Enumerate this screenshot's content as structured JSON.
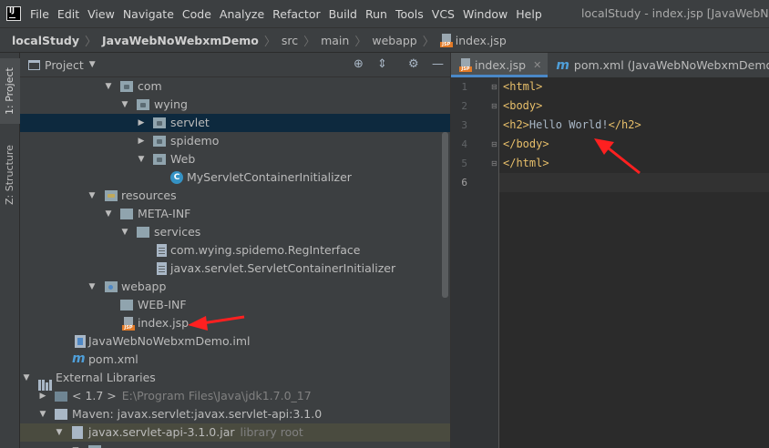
{
  "menubar": {
    "items": [
      "File",
      "Edit",
      "View",
      "Navigate",
      "Code",
      "Analyze",
      "Refactor",
      "Build",
      "Run",
      "Tools",
      "VCS",
      "Window",
      "Help"
    ],
    "window_title": "localStudy - index.jsp [JavaWebNoW"
  },
  "breadcrumb": [
    "localStudy",
    "JavaWebNoWebxmDemo",
    "src",
    "main",
    "webapp",
    "index.jsp"
  ],
  "toolstrip": {
    "project": "1: Project",
    "structure": "Z: Structure"
  },
  "project_panel": {
    "title": "Project",
    "tree": [
      {
        "label": "com",
        "icon": "folder-icon"
      },
      {
        "label": "wying",
        "icon": "folder-icon"
      },
      {
        "label": "servlet",
        "icon": "folder-icon"
      },
      {
        "label": "spidemo",
        "icon": "folder-icon"
      },
      {
        "label": "Web",
        "icon": "folder-icon"
      },
      {
        "label": "MyServletContainerInitializer",
        "icon": "class-icon"
      },
      {
        "label": "resources",
        "icon": "resources-folder-icon"
      },
      {
        "label": "META-INF",
        "icon": "folder-icon"
      },
      {
        "label": "services",
        "icon": "folder-icon"
      },
      {
        "label": "com.wying.spidemo.RegInterface",
        "icon": "file-icon"
      },
      {
        "label": "javax.servlet.ServletContainerInitializer",
        "icon": "file-icon"
      },
      {
        "label": "webapp",
        "icon": "web-folder-icon"
      },
      {
        "label": "WEB-INF",
        "icon": "folder-icon"
      },
      {
        "label": "index.jsp",
        "icon": "jsp-file-icon"
      },
      {
        "label": "JavaWebNoWebxmDemo.iml",
        "icon": "iml-file-icon"
      },
      {
        "label": "pom.xml",
        "icon": "maven-file-icon"
      },
      {
        "label": "External Libraries",
        "icon": "libraries-icon"
      },
      {
        "label": "< 1.7 >",
        "sub": "E:\\Program Files\\Java\\jdk1.7.0_17",
        "icon": "sdk-icon"
      },
      {
        "label": "Maven: javax.servlet:javax.servlet-api:3.1.0",
        "icon": "maven-lib-icon"
      },
      {
        "label": "javax.servlet-api-3.1.0.jar",
        "sub": "library root",
        "icon": "jar-icon"
      }
    ]
  },
  "editor": {
    "tabs": [
      {
        "label": "index.jsp",
        "active": true
      },
      {
        "label": "pom.xml (JavaWebNoWebxmDemo)",
        "active": false
      }
    ],
    "line_numbers": [
      "1",
      "2",
      "3",
      "4",
      "5",
      "6"
    ],
    "lines": [
      {
        "tag_open": "<html>",
        "text": "",
        "tag_close": ""
      },
      {
        "tag_open": "<body>",
        "text": "",
        "tag_close": ""
      },
      {
        "tag_open": "<h2>",
        "text": "Hello World!",
        "tag_close": "</h2>"
      },
      {
        "tag_open": "</body>",
        "text": "",
        "tag_close": ""
      },
      {
        "tag_open": "</html>",
        "text": "",
        "tag_close": ""
      },
      {
        "tag_open": "",
        "text": "",
        "tag_close": ""
      }
    ]
  },
  "colors": {
    "selection": "#0d293e",
    "hover_row": "#4a4b3f",
    "tag": "#e8bf6a",
    "annotation_arrow": "#ff2020"
  }
}
